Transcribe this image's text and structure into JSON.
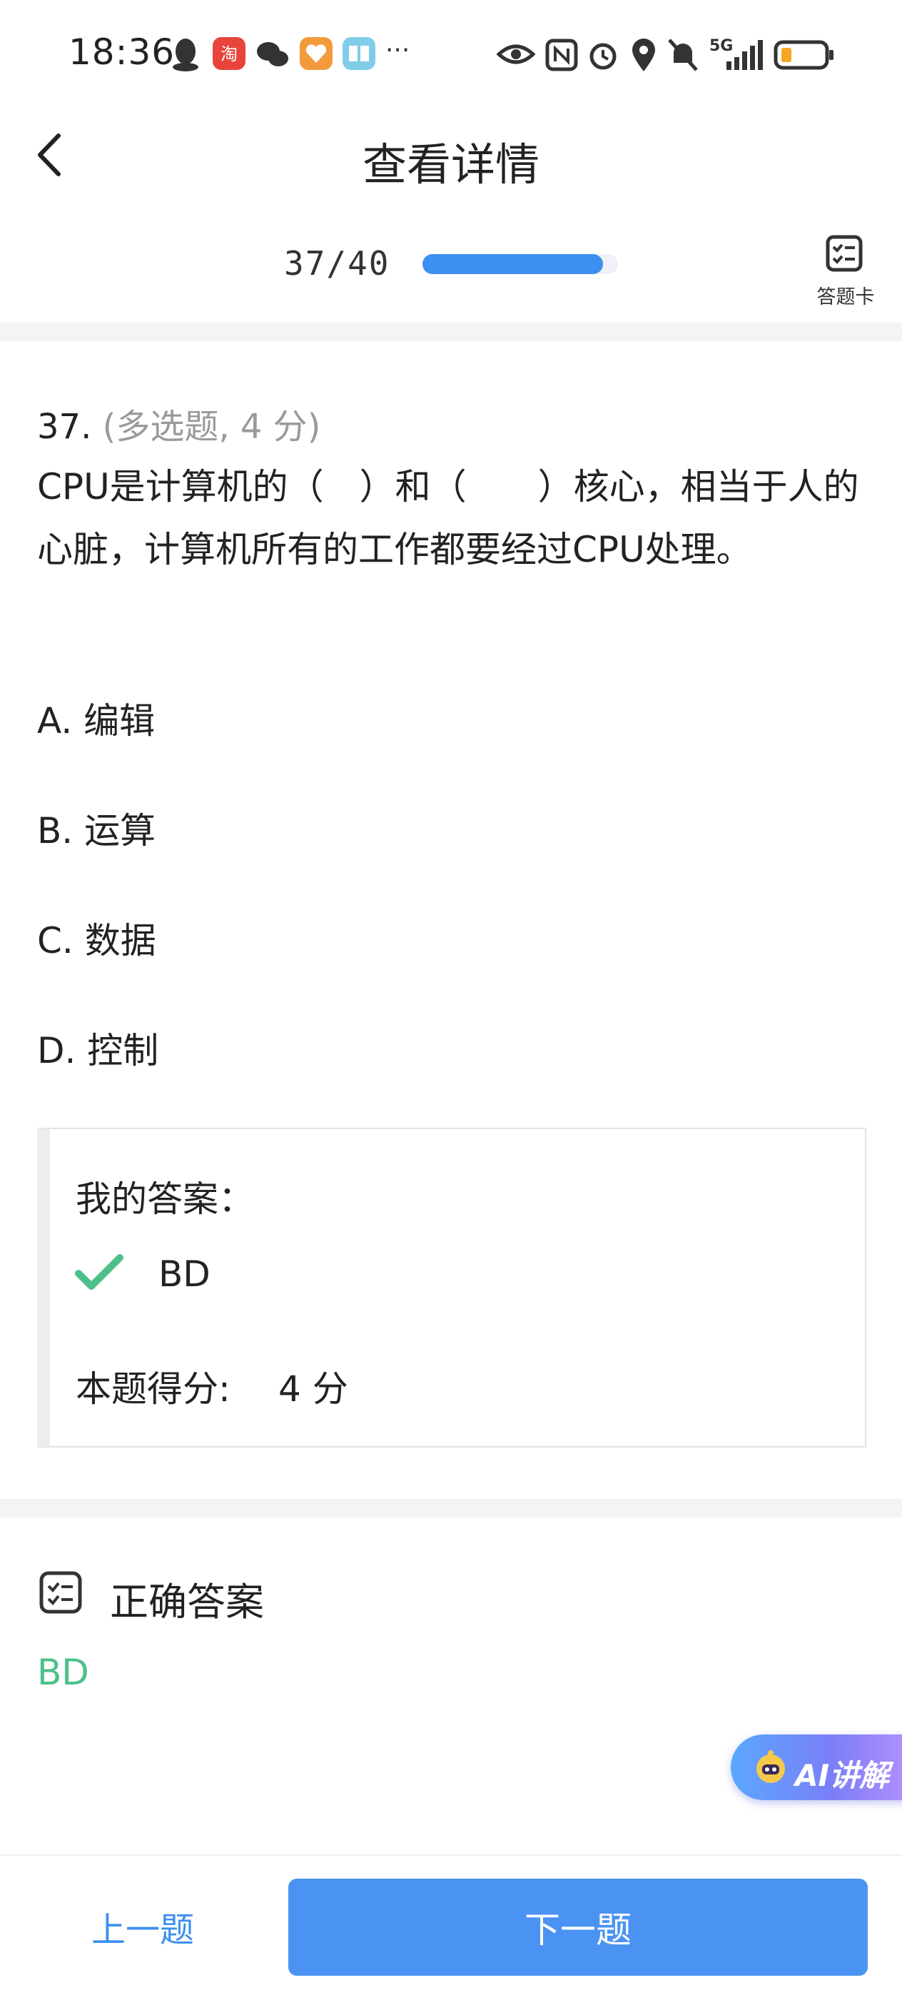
{
  "status_bar": {
    "time": "18:36",
    "network": "5G",
    "icons": [
      "qq-icon",
      "taobao-icon",
      "wechat-icon",
      "heart-app-icon",
      "reader-app-icon",
      "more-dots-icon",
      "eye-icon",
      "nfc-icon",
      "alarm-icon",
      "location-icon",
      "mute-icon",
      "signal-icon",
      "battery-icon"
    ],
    "more": "···"
  },
  "header": {
    "title": "查看详情",
    "back_icon": "back-arrow-icon"
  },
  "progress": {
    "current": 37,
    "total": 40,
    "text": "37/40",
    "fraction": 0.925
  },
  "answer_card": {
    "label": "答题卡",
    "icon": "checklist-icon"
  },
  "question": {
    "number": "37.",
    "type": "(多选题, 4 分)",
    "text": "CPU是计算机的（　）和（　　）核心，相当于人的心脏，计算机所有的工作都要经过CPU处理。",
    "options": [
      {
        "label": "A. 编辑"
      },
      {
        "label": "B. 运算"
      },
      {
        "label": "C. 数据"
      },
      {
        "label": "D. 控制"
      }
    ]
  },
  "my_answer": {
    "label": "我的答案：",
    "value": "BD",
    "status_icon": "check-icon",
    "score_label": "本题得分:",
    "score_value": "4 分"
  },
  "correct_answer": {
    "label": "正确答案",
    "value": "BD",
    "icon": "checklist-icon"
  },
  "ai_button": {
    "label": "AI讲解",
    "icon": "ai-robot-icon"
  },
  "bottom_nav": {
    "prev_label": "上一题",
    "next_label": "下一题"
  },
  "colors": {
    "accent": "#3d8ff0",
    "correct": "#4dc08a",
    "button": "#4a93f2"
  }
}
